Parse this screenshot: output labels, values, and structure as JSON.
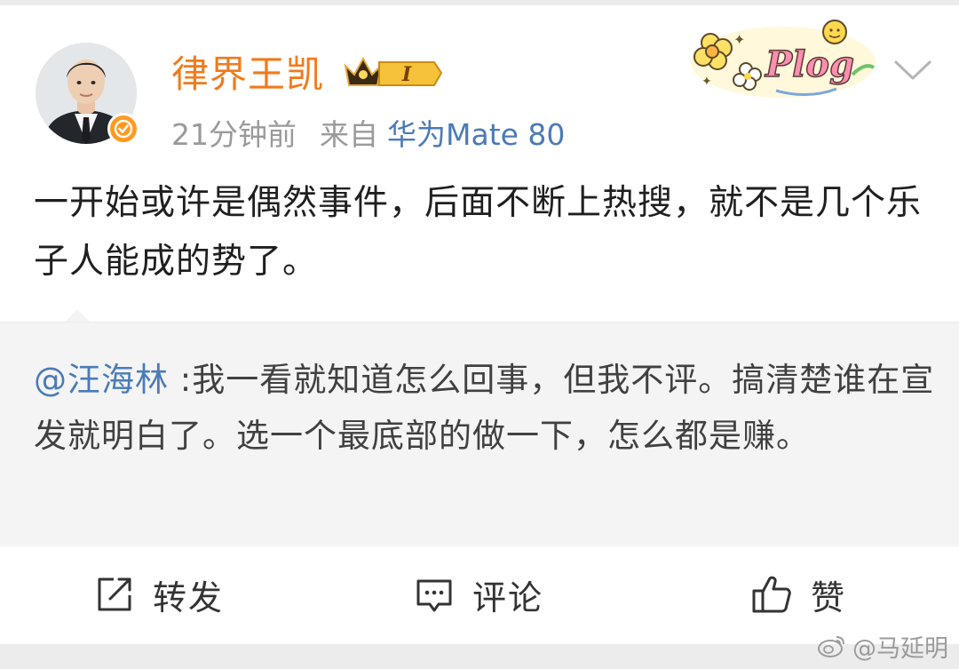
{
  "header": {
    "username": "律界王凯",
    "member_level": "I",
    "time_ago": "21分钟前",
    "from_label": "来自",
    "source_device": "华为Mate 80",
    "sticker_text": "Plog"
  },
  "post": {
    "text": "一开始或许是偶然事件，后面不断上热搜，就不是几个乐子人能成的势了。"
  },
  "repost": {
    "mention": "@汪海林",
    "text": " :我一看就知道怎么回事，但我不评。搞清楚谁在宣发就明白了。选一个最底部的做一下，怎么都是赚。"
  },
  "actions": {
    "repost_label": "转发",
    "comment_label": "评论",
    "like_label": "赞"
  },
  "watermark": {
    "text": "@马延明"
  },
  "icons": {
    "verified": "verified-badge-icon",
    "crown": "crown-icon",
    "menu": "chevron-down-icon",
    "repost": "repost-icon",
    "comment": "comment-icon",
    "like": "thumbs-up-icon",
    "weibo": "weibo-logo-icon"
  },
  "colors": {
    "username": "#f07b1a",
    "link": "#4a7bb7",
    "meta": "#9a9a9a",
    "repost_bg": "#f4f4f4",
    "verified": "#ff9a1f"
  }
}
